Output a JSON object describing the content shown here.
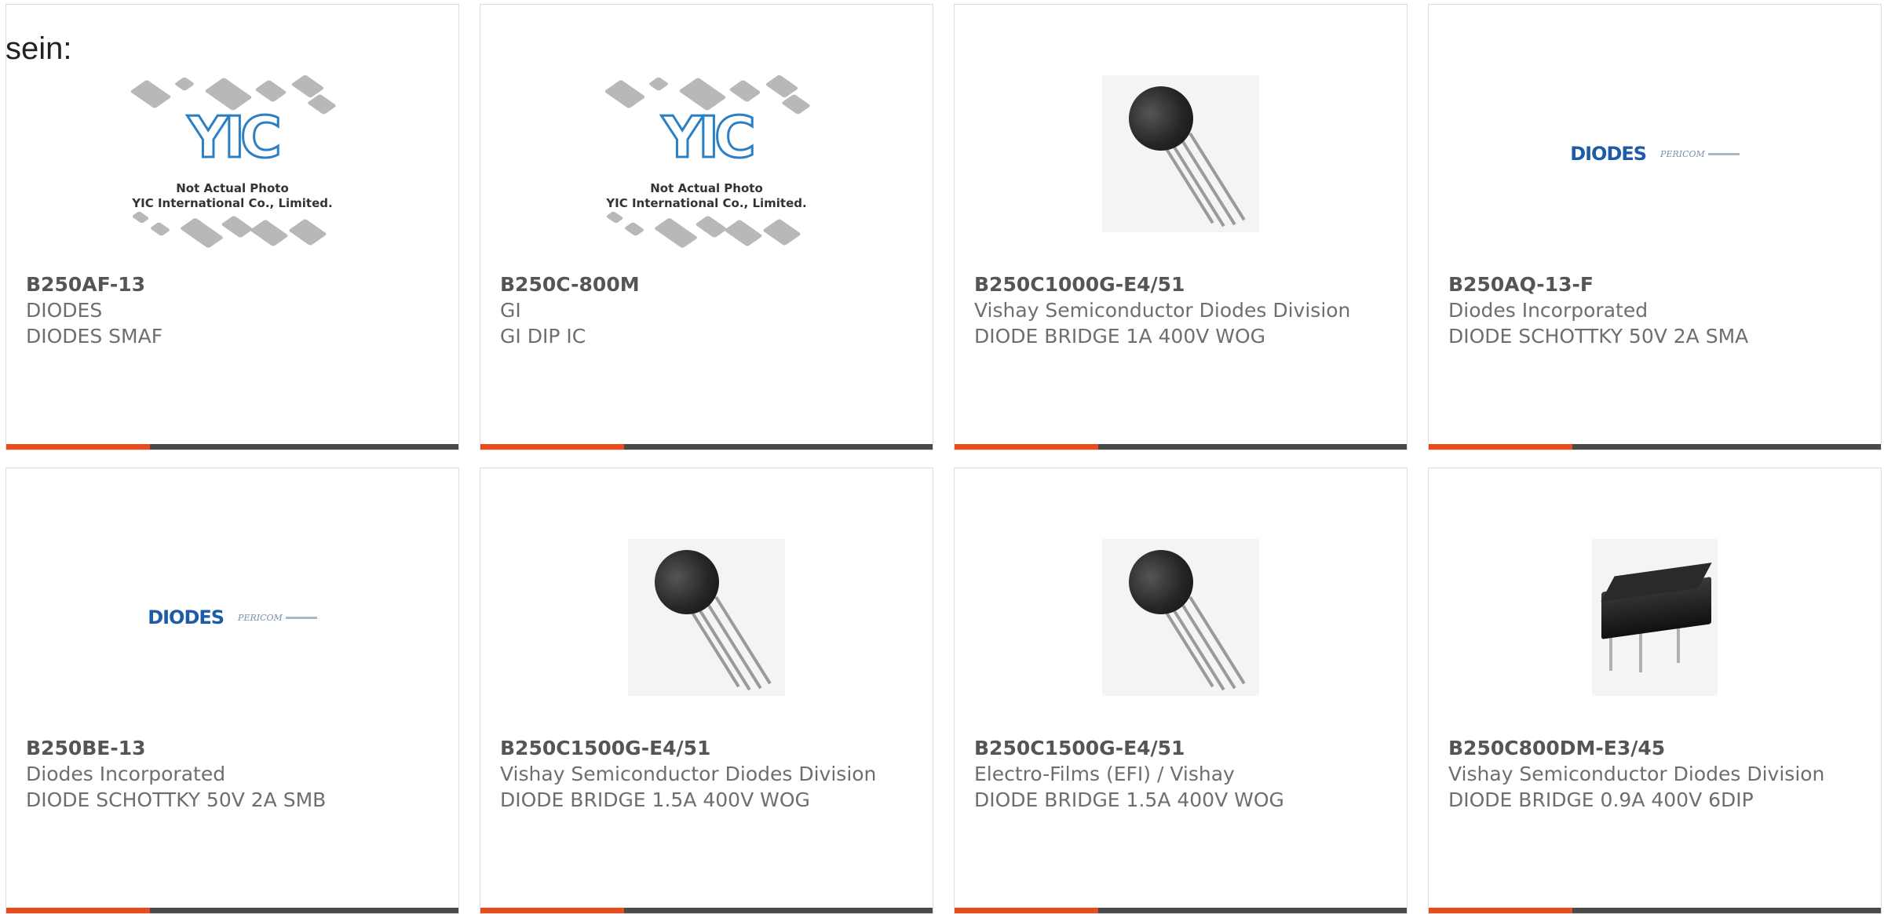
{
  "lead_text": "sein:",
  "placeholder": {
    "logo_text": "YIC",
    "caption_line1": "Not Actual Photo",
    "caption_line2": "YIC International Co., Limited."
  },
  "brand_logo": {
    "diodes": "DIODES",
    "pericom": "PERICOM"
  },
  "colors": {
    "accent": "#e84c1e",
    "bar": "#4a4a4a",
    "part_number": "#555555",
    "text": "#6e6e6e"
  },
  "products": [
    {
      "part_number": "B250AF-13",
      "manufacturer": "DIODES",
      "description": "DIODES SMAF",
      "image": "yic-placeholder"
    },
    {
      "part_number": "B250C-800M",
      "manufacturer": "GI",
      "description": "GI DIP IC",
      "image": "yic-placeholder"
    },
    {
      "part_number": "B250C1000G-E4/51",
      "manufacturer": "Vishay Semiconductor Diodes Division",
      "description": "DIODE BRIDGE 1A 400V WOG",
      "image": "wog-bridge-photo"
    },
    {
      "part_number": "B250AQ-13-F",
      "manufacturer": "Diodes Incorporated",
      "description": "DIODE SCHOTTKY 50V 2A SMA",
      "image": "diodes-pericom-logo"
    },
    {
      "part_number": "B250BE-13",
      "manufacturer": "Diodes Incorporated",
      "description": "DIODE SCHOTTKY 50V 2A SMB",
      "image": "diodes-pericom-logo"
    },
    {
      "part_number": "B250C1500G-E4/51",
      "manufacturer": "Vishay Semiconductor Diodes Division",
      "description": "DIODE BRIDGE 1.5A 400V WOG",
      "image": "wog-bridge-photo"
    },
    {
      "part_number": "B250C1500G-E4/51",
      "manufacturer": "Electro-Films (EFI) / Vishay",
      "description": "DIODE BRIDGE 1.5A 400V WOG",
      "image": "wog-bridge-photo"
    },
    {
      "part_number": "B250C800DM-E3/45",
      "manufacturer": "Vishay Semiconductor Diodes Division",
      "description": "DIODE BRIDGE 0.9A 400V 6DIP",
      "image": "dip-bridge-photo"
    }
  ]
}
